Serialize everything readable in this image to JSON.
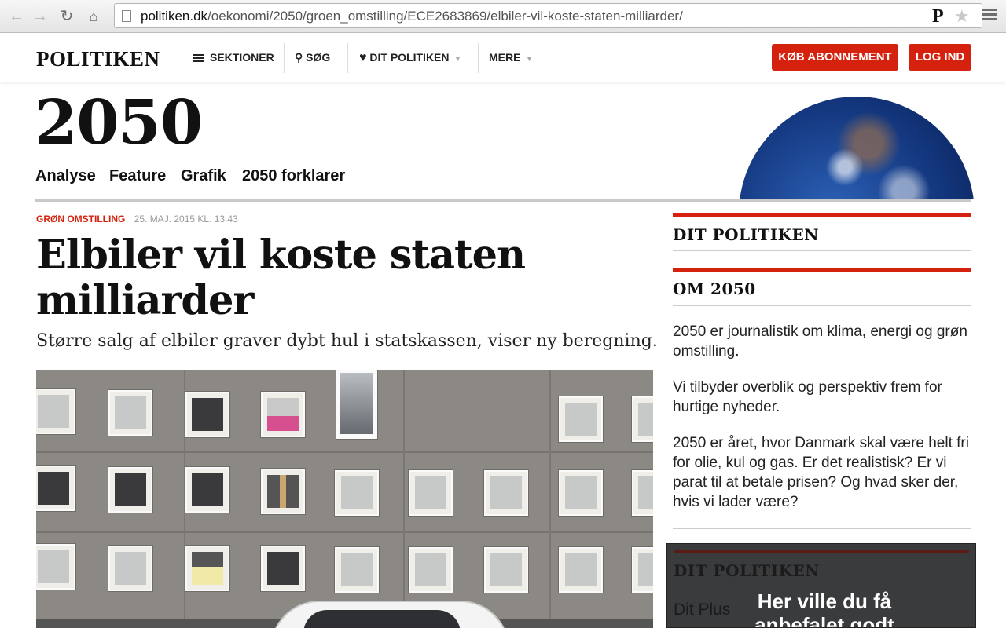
{
  "browser": {
    "url_host": "politiken.dk",
    "url_path": "/oekonomi/2050/groen_omstilling/ECE2683869/elbiler-vil-koste-staten-milliarder/",
    "extension_label": "P"
  },
  "header": {
    "logo": "POLITIKEN",
    "nav": {
      "sektioner": "SEKTIONER",
      "sog": "SØG",
      "dit_politiken": "DIT POLITIKEN",
      "mere": "MERE"
    },
    "buy_button": "KØB ABONNEMENT",
    "login_button": "LOG IND"
  },
  "section": {
    "title": "2050",
    "subnav": [
      "Analyse",
      "Feature",
      "Grafik",
      "2050 forklarer"
    ]
  },
  "article": {
    "category": "GRØN OMSTILLING",
    "date": "25. MAJ. 2015 KL. 13.43",
    "headline_line1": "Elbiler vil koste staten",
    "headline_line2": "milliarder",
    "subtitle": "Større salg af elbiler graver dybt hul i statskassen, viser ny beregning."
  },
  "sidebar": {
    "dit_politiken_title": "DIT POLITIKEN",
    "om_title": "OM 2050",
    "paragraphs": [
      "2050 er journalistik om klima, energi og grøn omstilling.",
      "Vi tilbyder overblik og perspektiv frem for hurtige nyheder.",
      "2050 er året, hvor Danmark skal være helt fri for olie, kul og gas. Er det realistisk? Er vi parat til at betale prisen? Og hvad sker der, hvis vi lader være?"
    ],
    "overlay": {
      "title": "DIT POLITIKEN",
      "subtitle": "Dit Plus",
      "message": "Her ville du få anbefalet godt"
    }
  },
  "colors": {
    "accent_red": "#d4220f",
    "globe_blue": "#13367d"
  }
}
